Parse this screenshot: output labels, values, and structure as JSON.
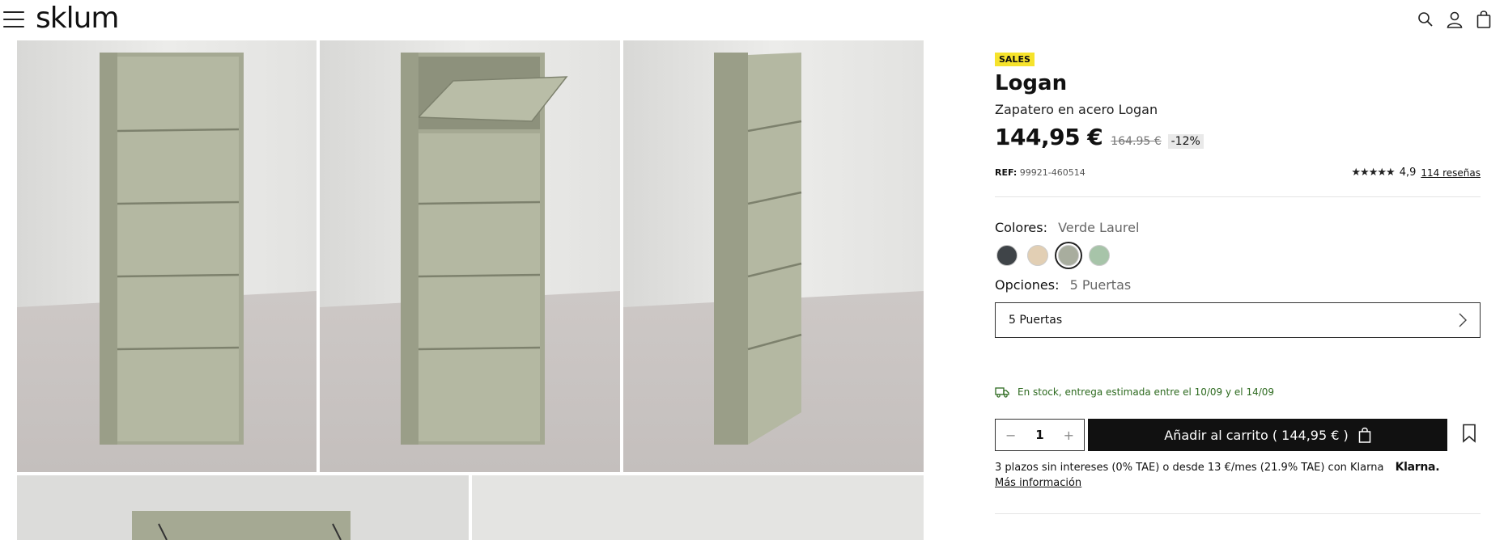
{
  "header": {
    "logo": "sklum",
    "icons": [
      "search-icon",
      "user-icon",
      "bag-icon",
      "menu-icon"
    ]
  },
  "product": {
    "badge": "SALES",
    "name": "Logan",
    "subtitle": "Zapatero en acero Logan",
    "price": "144,95 €",
    "old_price": "164.95 €",
    "discount": "-12%",
    "ref_label": "REF:",
    "ref_value": "99921-460514",
    "rating": "4,9",
    "stars": "★★★★★",
    "reviews": "114 reseñas"
  },
  "colors": {
    "label": "Colores:",
    "selected": "Verde Laurel",
    "swatches": [
      "#3f4448",
      "#e2cfb4",
      "#a8ad9e",
      "#a7c4a9"
    ]
  },
  "options": {
    "label": "Opciones:",
    "selected": "5 Puertas",
    "dropdown_value": "5 Puertas"
  },
  "stock": {
    "text": "En stock, entrega estimada entre el 10/09 y el 14/09"
  },
  "cart": {
    "minus": "−",
    "quantity": "1",
    "plus": "+",
    "add_label": "Añadir al carrito ( 144,95 € )"
  },
  "financing": {
    "text": "3 plazos sin intereses (0% TAE) o desde 13 €/mes (21.9% TAE) con Klarna",
    "brand": "Klarna.",
    "more_info": "Más información"
  }
}
